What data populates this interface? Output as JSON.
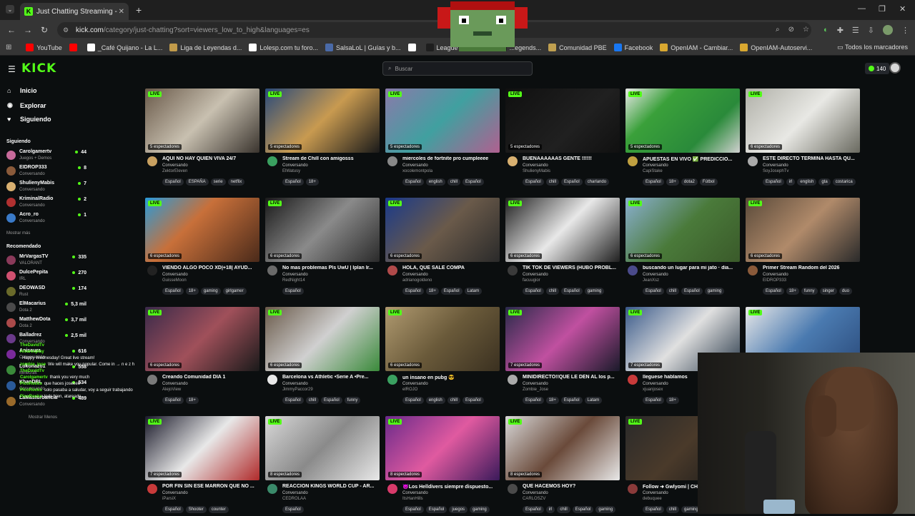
{
  "browser": {
    "tab_title": "Just Chatting Streaming - Live S",
    "url_host": "kick.com",
    "url_path": "/category/just-chatting?sort=viewers_low_to_high&languages=es",
    "bookmarks": [
      {
        "label": "YouTube",
        "color": "#ff0000"
      },
      {
        "label": "",
        "color": "#ff0000"
      },
      {
        "label": "_Café Quijano - La L...",
        "color": "#ffffff"
      },
      {
        "label": "Liga de Leyendas d...",
        "color": "#c29b4a"
      },
      {
        "label": "Lolesp.com tu foro...",
        "color": "#ffffff"
      },
      {
        "label": "SalsaLoL | Guías y b...",
        "color": "#4a6aa8"
      },
      {
        "label": "",
        "color": "#ffffff"
      },
      {
        "label": "League of Legends",
        "color": "#1e1e1e"
      },
      {
        "label": "...egends...",
        "color": "#1e1e1e"
      },
      {
        "label": "Comunidad PBE",
        "color": "#c0a050"
      },
      {
        "label": "Facebook",
        "color": "#1877f2"
      },
      {
        "label": "OpenIAM - Cambiar...",
        "color": "#d9a830"
      },
      {
        "label": "OpenIAM-Autoservi...",
        "color": "#d9a830"
      }
    ],
    "bookmarks_all": "Todos los marcadores"
  },
  "header": {
    "logo": "KICK",
    "search_placeholder": "Buscar",
    "points": "140"
  },
  "sidebar": {
    "nav": [
      {
        "label": "Inicio",
        "icon": "home-icon",
        "glyph": "⌂"
      },
      {
        "label": "Explorar",
        "icon": "compass-icon",
        "glyph": "◉"
      },
      {
        "label": "Siguiendo",
        "icon": "heart-icon",
        "glyph": "♥"
      }
    ],
    "following_title": "Siguiendo",
    "following": [
      {
        "name": "Carolgamertv",
        "cat": "Juegos + Demos",
        "count": "44",
        "color": "#c76a9a"
      },
      {
        "name": "EIDROP333",
        "cat": "Conversando",
        "count": "8",
        "color": "#8a5a3a"
      },
      {
        "name": "ShulienyMabis",
        "cat": "Conversando",
        "count": "7",
        "color": "#d8b070"
      },
      {
        "name": "KriminalRadio",
        "cat": "Conversando",
        "count": "2",
        "color": "#b03030"
      },
      {
        "name": "Acro_ro",
        "cat": "Conversando",
        "count": "1",
        "color": "#3a7ac8"
      }
    ],
    "show_more": "Mostrar más",
    "recommended_title": "Recomendado",
    "recommended": [
      {
        "name": "MrVargasTV",
        "cat": "VALORANT",
        "count": "335",
        "color": "#8a3a5a"
      },
      {
        "name": "DulcePepita",
        "cat": "IRL",
        "count": "270",
        "color": "#d05070"
      },
      {
        "name": "DEOWASD",
        "cat": "Rust",
        "count": "174",
        "color": "#6a6a2a"
      },
      {
        "name": "ElMacarius",
        "cat": "Dota 2",
        "count": "5,3 mil",
        "color": "#4a4a4a"
      },
      {
        "name": "MatthewDota",
        "cat": "Dota 2",
        "count": "3,7 mil",
        "color": "#aa4a4a"
      },
      {
        "name": "Balladrez",
        "cat": "Conversando",
        "count": "2,5 mil",
        "color": "#6a3a8a"
      },
      {
        "name": "Anisaura",
        "cat": "Conversando",
        "count": "616",
        "color": "#7a2a9a"
      },
      {
        "name": "Lokonazo1",
        "cat": "Minecraft",
        "count": "558",
        "color": "#3a8a3a"
      },
      {
        "name": "KhanDBL",
        "cat": "Conversando",
        "count": "534",
        "color": "#2a5a9a"
      },
      {
        "name": "LaMasturbancia",
        "cat": "Conversando",
        "count": "489",
        "color": "#9a6a2a"
      }
    ],
    "show_less": "Mostrar Menos"
  },
  "chat": [
    {
      "user": "TheDavidTv",
      "msg": ""
    },
    {
      "user": "Alvarexplay",
      "msg": ""
    },
    {
      "user": "",
      "msg": "Happy Wednesday! Great live stream!"
    },
    {
      "user": "zombie_jose",
      "msg": "We will make you popular. Come in → n e z h n a . c o m"
    },
    {
      "user": "TheDavidTv",
      "msg": ""
    },
    {
      "user": "Carolgamertv",
      "msg": "thank you very much"
    },
    {
      "user": "PicoRocks",
      "msg": "que haces joseeee"
    },
    {
      "user": "PicoRocks",
      "msg": "solo pasaba a saludar, voy a seguir trabajando"
    },
    {
      "user": "PicoRocks",
      "msg": "todo bien, atareado"
    }
  ],
  "cards": [
    {
      "title": "AQUI NO HAY QUIEN VIVA 24/7",
      "streamer": "ZektorEleven",
      "viewers": "5 espectadores",
      "tags": [
        "Español",
        "ESPAÑA",
        "serie",
        "netflix"
      ],
      "thumb": "linear-gradient(135deg,#6a5a4a,#c8c0b0 50%,#3a342e)",
      "ava": "#c8a060"
    },
    {
      "title": "Stream de Chill con amigosss",
      "streamer": "ElWatusy",
      "viewers": "5 espectadores",
      "tags": [
        "Español",
        "18+"
      ],
      "thumb": "linear-gradient(135deg,#2a4a7a,#c89a50 50%,#1a1a1a)",
      "ava": "#3aa060"
    },
    {
      "title": "miercoles de fortnite pro cumpleeee",
      "streamer": "xocolemontpola",
      "viewers": "5 espectadores",
      "tags": [
        "Español",
        "english",
        "chill",
        "Español"
      ],
      "thumb": "linear-gradient(135deg,#8a7aaa,#40a0a0 50%,#b06090)",
      "ava": "#888888"
    },
    {
      "title": "BUENAAAAAAS GENTE !!!!!!",
      "streamer": "ShulienyMabis",
      "viewers": "5 espectadores",
      "tags": [
        "Español",
        "chill",
        "Español",
        "charlando"
      ],
      "thumb": "linear-gradient(135deg,#101010,#202020 60%,#101010)",
      "ava": "#d8b070"
    },
    {
      "title": "APUESTAS EN VIVO ✅ PREDICCIO...",
      "streamer": "CapiStake",
      "viewers": "5 espectadores",
      "tags": [
        "Español",
        "18+",
        "dota2",
        "Fútbol"
      ],
      "thumb": "linear-gradient(135deg,#e8e8e8,#3aa03a 30%,#2a8a3a 70%,#d0d0d0)",
      "ava": "#c0a040"
    },
    {
      "title": "ESTE DIRECTO TERMINA HASTA QU...",
      "streamer": "SoyJosephTv",
      "viewers": "6 espectadores",
      "tags": [
        "Español",
        "irl",
        "english",
        "gta",
        "costarica"
      ],
      "thumb": "linear-gradient(135deg,#b0b0a8,#e8e8e4 50%,#6a6a60)",
      "ava": "#aaaaaa"
    },
    {
      "title": "VIENDO ALGO POCO XD|+18| AYUD...",
      "streamer": "GuisseMoon",
      "viewers": "6 espectadores",
      "tags": [
        "Español",
        "18+",
        "gaming",
        "girlgamer"
      ],
      "thumb": "linear-gradient(135deg,#2a9ad8,#c8703a 40%,#4a2a1a)",
      "ava": "#222222"
    },
    {
      "title": "No mas problemas Pls UwU | Iplan Ir...",
      "streamer": "RedNight14",
      "viewers": "6 espectadores",
      "tags": [
        "Español"
      ],
      "thumb": "linear-gradient(135deg,#1a1a1a,#8a8a8a 50%,#2a2a2a)",
      "ava": "#6a6a6a"
    },
    {
      "title": "HOLA, QUE SALE COMPA",
      "streamer": "adrianogoldeno",
      "viewers": "6 espectadores",
      "tags": [
        "Español",
        "18+",
        "Español",
        "Latam"
      ],
      "thumb": "linear-gradient(135deg,#1a3a8a,#6a5a4a 50%,#2a2a2a)",
      "ava": "#b04a4a"
    },
    {
      "title": "TIK TOK DE VIEWERS (HUBO PROBL...",
      "streamer": "facuugior",
      "viewers": "6 espectadores",
      "tags": [
        "Español",
        "chill",
        "Español",
        "gaming"
      ],
      "thumb": "linear-gradient(135deg,#202020,#e8e8e8 50%,#202020)",
      "ava": "#3a3a3a"
    },
    {
      "title": "buscando un lugar para mi jato · dia...",
      "streamer": "JeanXsz",
      "viewers": "6 espectadores",
      "tags": [
        "Español",
        "chill",
        "Español",
        "gaming"
      ],
      "thumb": "linear-gradient(135deg,#8ab0d0,#4a7a3a 50%,#3a5a2a)",
      "ava": "#4a4a8a"
    },
    {
      "title": "Primer Stream Random del 2026",
      "streamer": "EIDROP333",
      "viewers": "6 espectadores",
      "tags": [
        "Español",
        "18+",
        "funny",
        "singer",
        "duo"
      ],
      "thumb": "linear-gradient(135deg,#5a4a3a,#b08a6a 50%,#2a2a2a)",
      "ava": "#8a5a3a"
    },
    {
      "title": "Creando Comunidad DIA 1",
      "streamer": "AlejoView",
      "viewers": "6 espectadores",
      "tags": [
        "Español",
        "18+"
      ],
      "thumb": "linear-gradient(135deg,#3a2a4a,#a0505a 50%,#1a1a1a)",
      "ava": "#7a7a7a"
    },
    {
      "title": "Barcelona vs Athletic •Serie A •Pre...",
      "streamer": "JimmyPaccor29",
      "viewers": "6 espectadores",
      "tags": [
        "Español",
        "chill",
        "Español",
        "funny"
      ],
      "thumb": "linear-gradient(135deg,#6a5a4a,#d0d0d0 50%,#3a8a3a)",
      "ava": "#e8e8e8"
    },
    {
      "title": "un insano en pubg 😎",
      "streamer": "elROJO",
      "viewers": "6 espectadores",
      "tags": [
        "Español",
        "english",
        "chill",
        "Español"
      ],
      "thumb": "linear-gradient(135deg,#b09a70,#6a5a3a 50%,#3a3020)",
      "ava": "#3aa060"
    },
    {
      "title": "MINIDIRECTO!!QUE LE DEN AL los p...",
      "streamer": "Zombie_Jose",
      "viewers": "7 espectadores",
      "tags": [
        "Español",
        "18+",
        "Español",
        "Latam"
      ],
      "thumb": "linear-gradient(135deg,#2a2a4a,#c050a0 50%,#1a1a2a)",
      "ava": "#aaaaaa"
    },
    {
      "title": "lleguese hablamos",
      "streamer": "xjuanjosex",
      "viewers": "7 espectadores",
      "tags": [
        "Español",
        "18+"
      ],
      "thumb": "linear-gradient(135deg,#3a5a8a,#e0e0e0 50%,#2a3a4a)",
      "ava": "#c83a3a"
    },
    {
      "title": "",
      "streamer": "",
      "viewers": "",
      "tags": [],
      "thumb": "linear-gradient(135deg,#e8e8e8,#4a7ab0 50%,#2a4a7a)",
      "ava": "#0b0e0f"
    },
    {
      "title": "POR FIN SIN ESE MARRON QUE NO ...",
      "streamer": "iParsiX",
      "viewers": "7 espectadores",
      "tags": [
        "Español",
        "Shooter",
        "counter"
      ],
      "thumb": "linear-gradient(135deg,#1a1a2a,#e8e8e8 50%,#b02a2a)",
      "ava": "#c83a3a"
    },
    {
      "title": "REACCION KINGS WORLD CUP - AR...",
      "streamer": "CEDROLAA",
      "viewers": "8 espectadores",
      "tags": [
        "Español"
      ],
      "thumb": "linear-gradient(135deg,#d8d8d8,#8a8a8a 50%,#e8e8e8)",
      "ava": "#3a8a6a"
    },
    {
      "title": "😈Los Helldivers siempre dispuesto...",
      "streamer": "ItsHanHills",
      "viewers": "8 espectadores",
      "tags": [
        "Español",
        "Español",
        "juegos",
        "gaming"
      ],
      "thumb": "linear-gradient(135deg,#6a2a8a,#e05aa0 50%,#3a1a5a)",
      "ava": "#d83a6a"
    },
    {
      "title": "QUE HACEMOS HOY?",
      "streamer": "CARLOSZV",
      "viewers": "8 espectadores",
      "tags": [
        "Español",
        "irl",
        "chill",
        "Español",
        "gaming"
      ],
      "thumb": "linear-gradient(135deg,#d8d8d8,#6a4a3a 50%,#e8e8e8)",
      "ava": "#4a4a4a"
    },
    {
      "title": "Follow ➜ Gwlyomi | CH",
      "streamer": "debuquee",
      "viewers": "",
      "tags": [
        "Español",
        "chill",
        "gaming",
        "fun"
      ],
      "thumb": "linear-gradient(135deg,#2a2a2a,#4a3a2a 50%,#1a1a1a)",
      "ava": "#8a3a3a"
    }
  ],
  "common": {
    "live": "LIVE",
    "category": "Conversando"
  },
  "colors": {
    "accent": "#53fc18",
    "bg": "#0b0e0f"
  }
}
